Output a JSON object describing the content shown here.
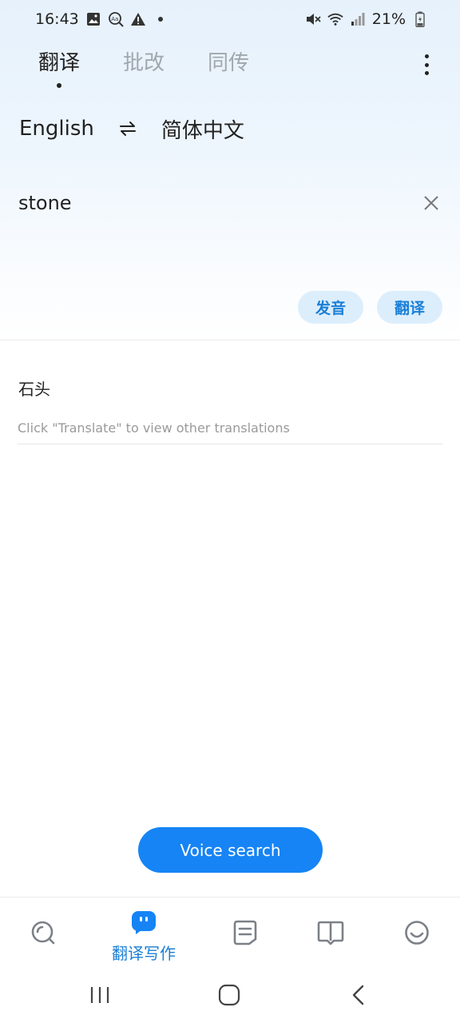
{
  "status_bar": {
    "time": "16:43",
    "battery": "21%",
    "left_icons": [
      "image-icon",
      "text-search-icon",
      "warning-icon",
      "dot-icon"
    ],
    "right_icons": [
      "mute-icon",
      "wifi-icon",
      "signal-icon",
      "battery-icon"
    ]
  },
  "header": {
    "tabs": [
      {
        "label": "翻译",
        "active": true
      },
      {
        "label": "批改",
        "active": false
      },
      {
        "label": "同传",
        "active": false
      }
    ]
  },
  "languages": {
    "source": "English",
    "target": "简体中文"
  },
  "input": {
    "text": "stone"
  },
  "actions": {
    "pronounce_label": "发音",
    "translate_label": "翻译"
  },
  "result": {
    "text": "石头",
    "hint": "Click \"Translate\" to view other translations"
  },
  "voice_search": {
    "label": "Voice search"
  },
  "bottom_nav": {
    "items": [
      {
        "icon": "search-icon",
        "label": "",
        "active": false
      },
      {
        "icon": "chat-bot-icon",
        "label": "翻译写作",
        "active": true
      },
      {
        "icon": "notes-icon",
        "label": "",
        "active": false
      },
      {
        "icon": "book-icon",
        "label": "",
        "active": false
      },
      {
        "icon": "smile-icon",
        "label": "",
        "active": false
      }
    ]
  },
  "colors": {
    "accent": "#1684f5",
    "active_label": "#1a7fd6",
    "pill_bg": "#dceefc"
  }
}
